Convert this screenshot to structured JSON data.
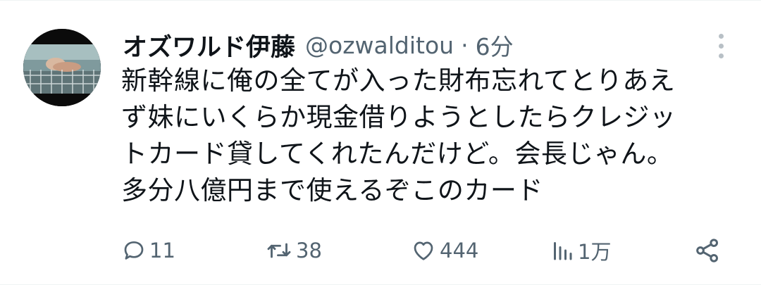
{
  "author": {
    "display_name": "オズワルド伊藤",
    "handle": "@ozwalditou",
    "separator": "·",
    "time": "6分"
  },
  "tweet": {
    "lines": [
      "新幹線に俺の全てが入った財布忘れてとりあえ",
      "ず妹にいくらか現金借りようとしたらクレジッ",
      "トカード貸してくれたんだけど。会長じゃん。",
      "多分八億円まで使えるぞこのカード"
    ]
  },
  "actions": {
    "replies": "11",
    "retweets": "38",
    "likes": "444",
    "views": "1万"
  },
  "icons": {
    "reply": "reply-bubble-icon",
    "retweet": "retweet-icon",
    "like": "heart-icon",
    "views": "views-bar-chart-icon",
    "share": "share-icon",
    "more": "more-vertical-icon"
  },
  "colors": {
    "text": "#0f1419",
    "secondary": "#536471",
    "more_dots": "#b8c0c6"
  }
}
